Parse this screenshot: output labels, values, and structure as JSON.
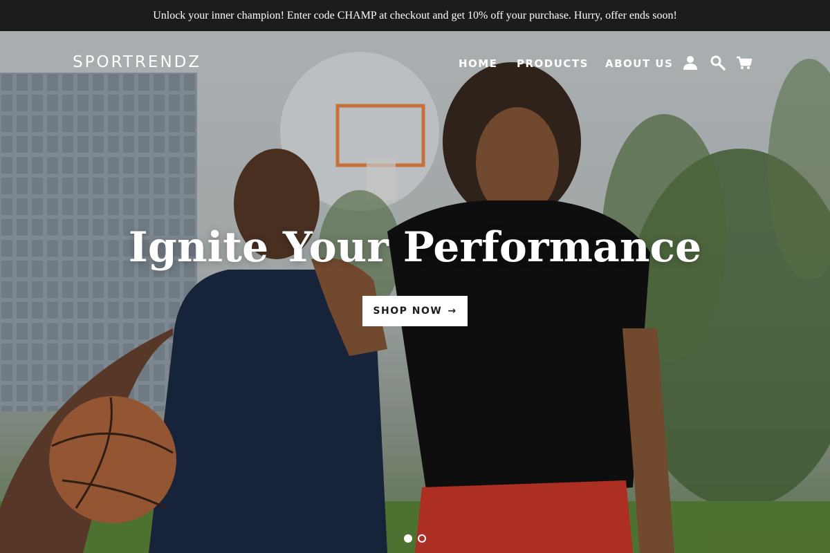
{
  "announcement": {
    "text": "Unlock your inner champion! Enter code CHAMP at checkout and get 10% off your purchase. Hurry, offer ends soon!"
  },
  "header": {
    "logo": "SPORTRENDZ",
    "nav": [
      {
        "label": "HOME"
      },
      {
        "label": "PRODUCTS"
      },
      {
        "label": "ABOUT US"
      }
    ],
    "icons": [
      "account-icon",
      "search-icon",
      "cart-icon"
    ]
  },
  "hero": {
    "headline": "Ignite Your Performance",
    "cta_label": "SHOP NOW",
    "cta_arrow": "→",
    "slides": {
      "current": 1,
      "total": 2
    }
  },
  "colors": {
    "announcement_bg": "#1c1c1c",
    "text": "#ffffff",
    "cta_bg": "#ffffff",
    "cta_text": "#1c1c1c"
  }
}
